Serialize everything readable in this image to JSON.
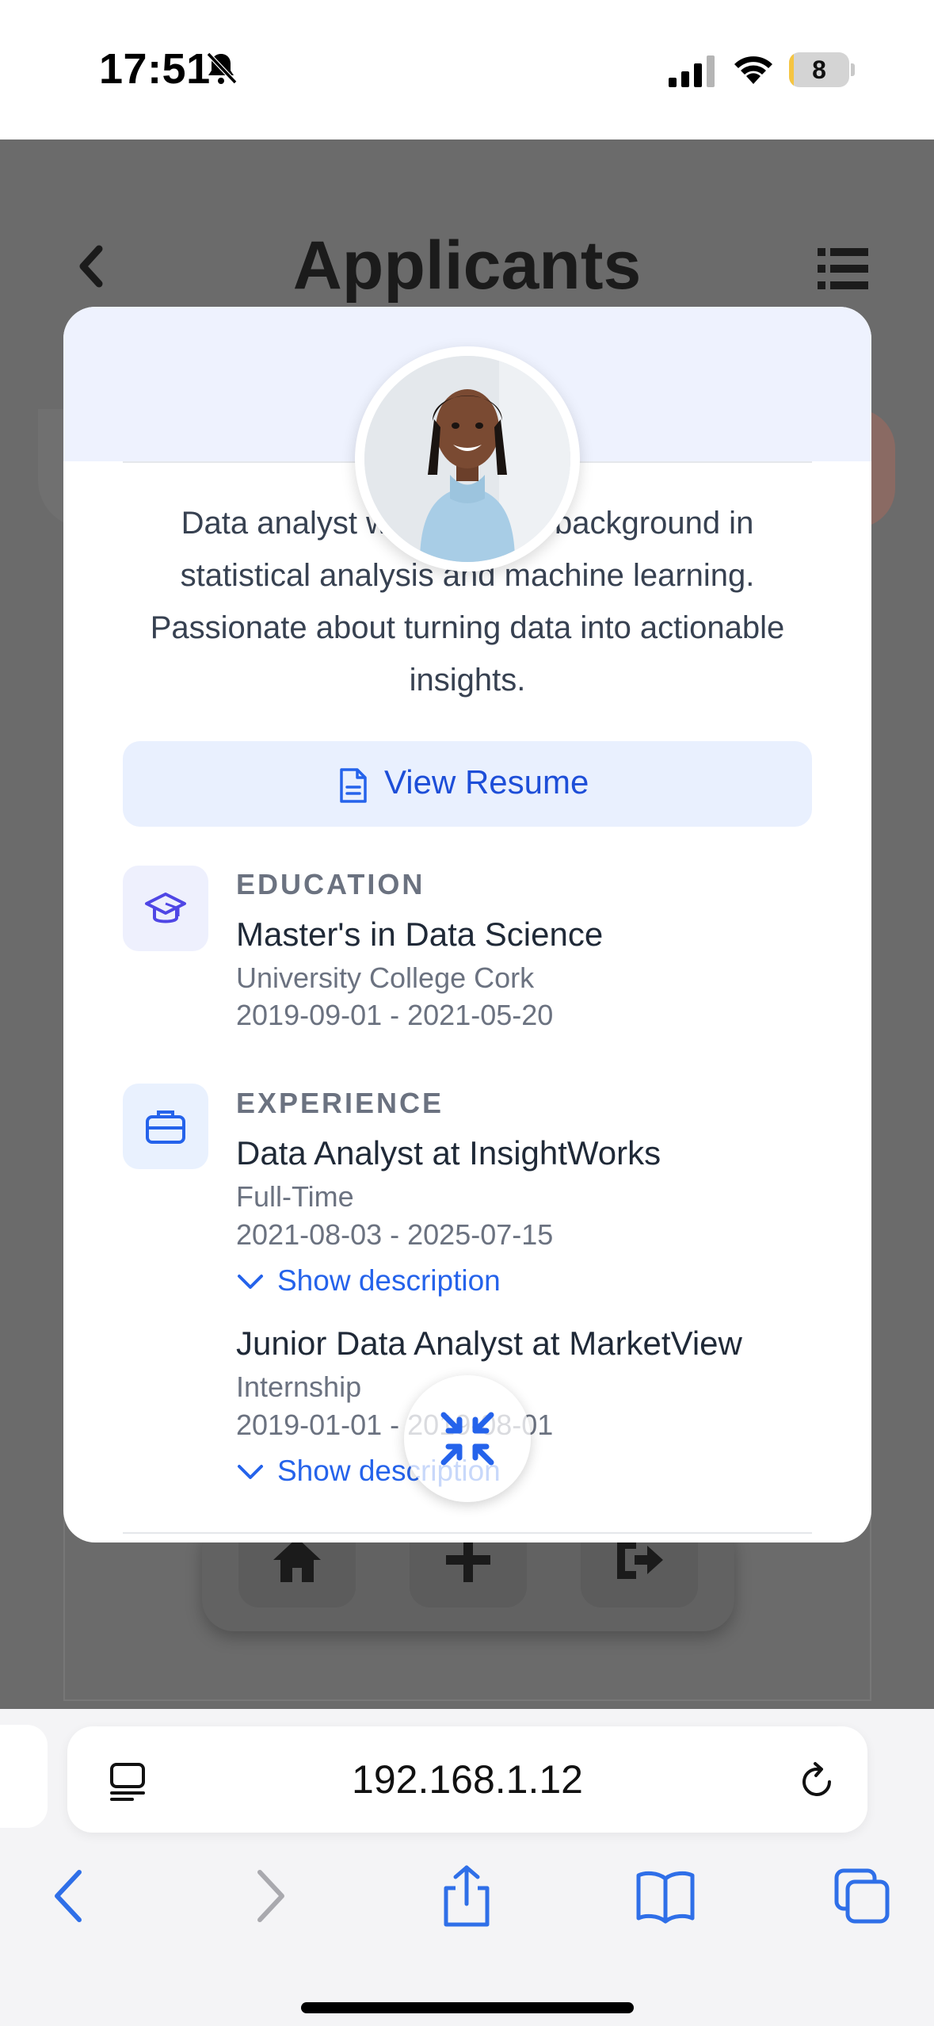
{
  "status_bar": {
    "time": "17:51",
    "battery_level": "8",
    "battery_fraction": 0.08,
    "icons": [
      "bell-slash-icon",
      "cellular-signal-icon",
      "wifi-icon",
      "battery-icon"
    ]
  },
  "background_page": {
    "title": "Applicants",
    "icons": [
      "chevron-left-icon",
      "list-icon",
      "home-icon",
      "plus-icon",
      "logout-icon"
    ]
  },
  "modal": {
    "bio": "Data analyst with a strong background in statistical analysis and machine learning. Passionate about turning data into actionable insights.",
    "resume_button": {
      "label": "View Resume",
      "icon": "document-icon"
    },
    "education": {
      "heading": "EDUCATION",
      "icon": "graduation-cap-icon",
      "degree": "Master's in Data Science",
      "institution": "University College Cork",
      "dates": "2019-09-01 - 2021-05-20"
    },
    "experience": {
      "heading": "EXPERIENCE",
      "icon": "briefcase-icon",
      "items": [
        {
          "title": "Data Analyst at InsightWorks",
          "type": "Full-Time",
          "dates": "2021-08-03 - 2025-07-15",
          "toggle": "Show description"
        },
        {
          "title": "Junior Data Analyst at MarketView",
          "type": "Internship",
          "dates": "2019-01-01 - 2019-08-01",
          "toggle": "Show description"
        }
      ]
    },
    "colors": {
      "accent": "#2563eb",
      "header_bg": "#eef2fe",
      "education_icon": "#4f46e5"
    }
  },
  "browser": {
    "url": "192.168.1.12",
    "icons": [
      "reader-icon",
      "reload-icon",
      "back-icon",
      "forward-icon",
      "share-icon",
      "bookmarks-icon",
      "tabs-icon"
    ]
  }
}
